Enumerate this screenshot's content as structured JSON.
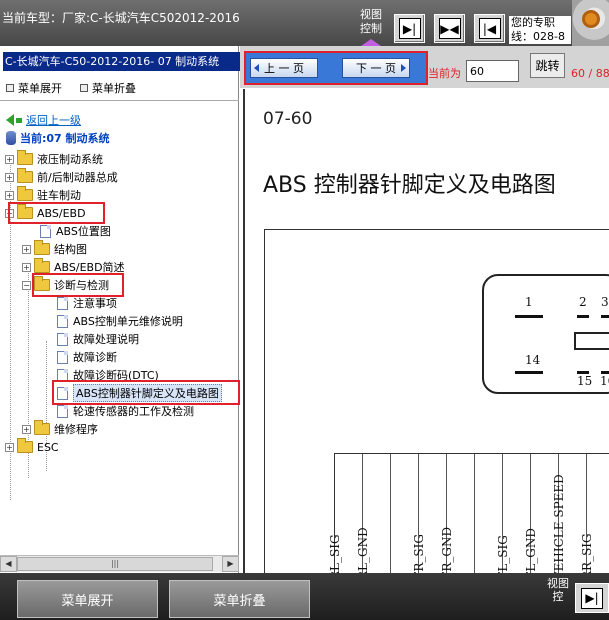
{
  "top": {
    "car_label": "当前车型：厂家:C-长城汽车C502012-2016",
    "view_control": "视图控制",
    "icons": [
      "arrow-right-icon",
      "double-arrow-icon",
      "arrow-left-icon"
    ],
    "notice": "您的专职\n线：028-8"
  },
  "left": {
    "header": "C-长城汽车-C50-2012-2016- 07 制动系统",
    "expand_label": "菜单展开",
    "collapse_label": "菜单折叠",
    "back_label": "返回上一级",
    "current_label": "当前:07 制动系统",
    "tree": {
      "hydraulic": "液压制动系统",
      "front_rear": "前/后制动器总成",
      "parking": "驻车制动",
      "abs_ebd": "ABS/EBD",
      "abs_position": "ABS位置图",
      "structure": "结构图",
      "abs_intro": "ABS/EBD简述",
      "diagnosis": "诊断与检测",
      "notes": "注意事项",
      "abs_repair": "ABS控制单元维修说明",
      "fault_handling": "故障处理说明",
      "fault_diagnosis": "故障诊断",
      "dtc": "故障诊断码(DTC)",
      "abs_pinout": "ABS控制器针脚定义及电路图",
      "wheel_speed": "轮速传感器的工作及检测",
      "repair_procedure": "维修程序",
      "esc": "ESC"
    }
  },
  "nav": {
    "prev_label": "上 一 页",
    "next_label": "下 一 页",
    "current_prefix": "当前为",
    "page_value": "60",
    "jump_label": "跳转",
    "page_count": "60 / 88"
  },
  "doc": {
    "page_num": "07-60",
    "title": "ABS 控制器针脚定义及电路图",
    "pins": [
      "1",
      "2",
      "3",
      "14",
      "15",
      "16"
    ],
    "columns": [
      "RL_SIG",
      "RL_GND",
      "",
      "FR_SIG",
      "FR_GND",
      "",
      "FL_SIG",
      "FL_GND",
      "VEHICLE SPEED",
      "RR_SIG"
    ]
  },
  "bottom": {
    "expand_label": "菜单展开",
    "collapse_label": "菜单折叠",
    "view_control": "视图控"
  }
}
